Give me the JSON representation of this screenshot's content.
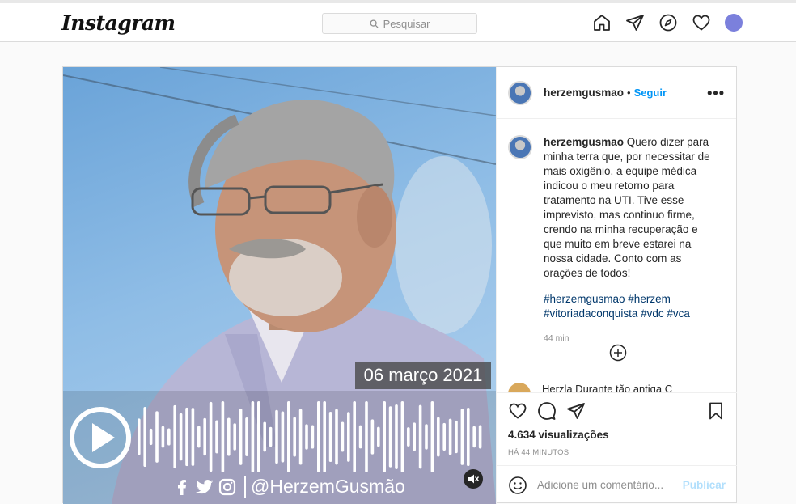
{
  "header": {
    "logo_text": "Instagram",
    "search_placeholder": "Pesquisar",
    "icons": [
      "home-icon",
      "send-icon",
      "explore-icon",
      "heart-icon",
      "profile-avatar"
    ],
    "avatar_color": "#7b80dc"
  },
  "media": {
    "date_text": "06 março 2021",
    "social_handle": "@HerzemGusmão",
    "social_icons": [
      "facebook-icon",
      "twitter-icon",
      "instagram-icon"
    ],
    "mute_icon": "muted-speaker-icon",
    "play_icon": "play-icon"
  },
  "post": {
    "username": "herzemgusmao",
    "dot": "•",
    "follow_label": "Seguir",
    "more_label": "•••",
    "caption_text": "Quero dizer para minha terra que, por necessitar de mais oxigênio, a equipe médica indicou o meu retorno para tratamento na UTI. Tive esse imprevisto, mas continuo firme, crendo na minha recuperação e que muito em breve estarei na nossa cidade. Conto com as orações de todos!",
    "hashtags": "#herzemgusmao #herzem #vitoriadaconquista #vdc #vca",
    "caption_time": "44 min",
    "comment_peek": "Herzla Durante tão antiga C",
    "views": "4.634 visualizações",
    "time_ago": "HÁ 44 MINUTOS",
    "comment_placeholder": "Adicione um comentário...",
    "publish_label": "Publicar",
    "accent_color": "#0095f6"
  }
}
